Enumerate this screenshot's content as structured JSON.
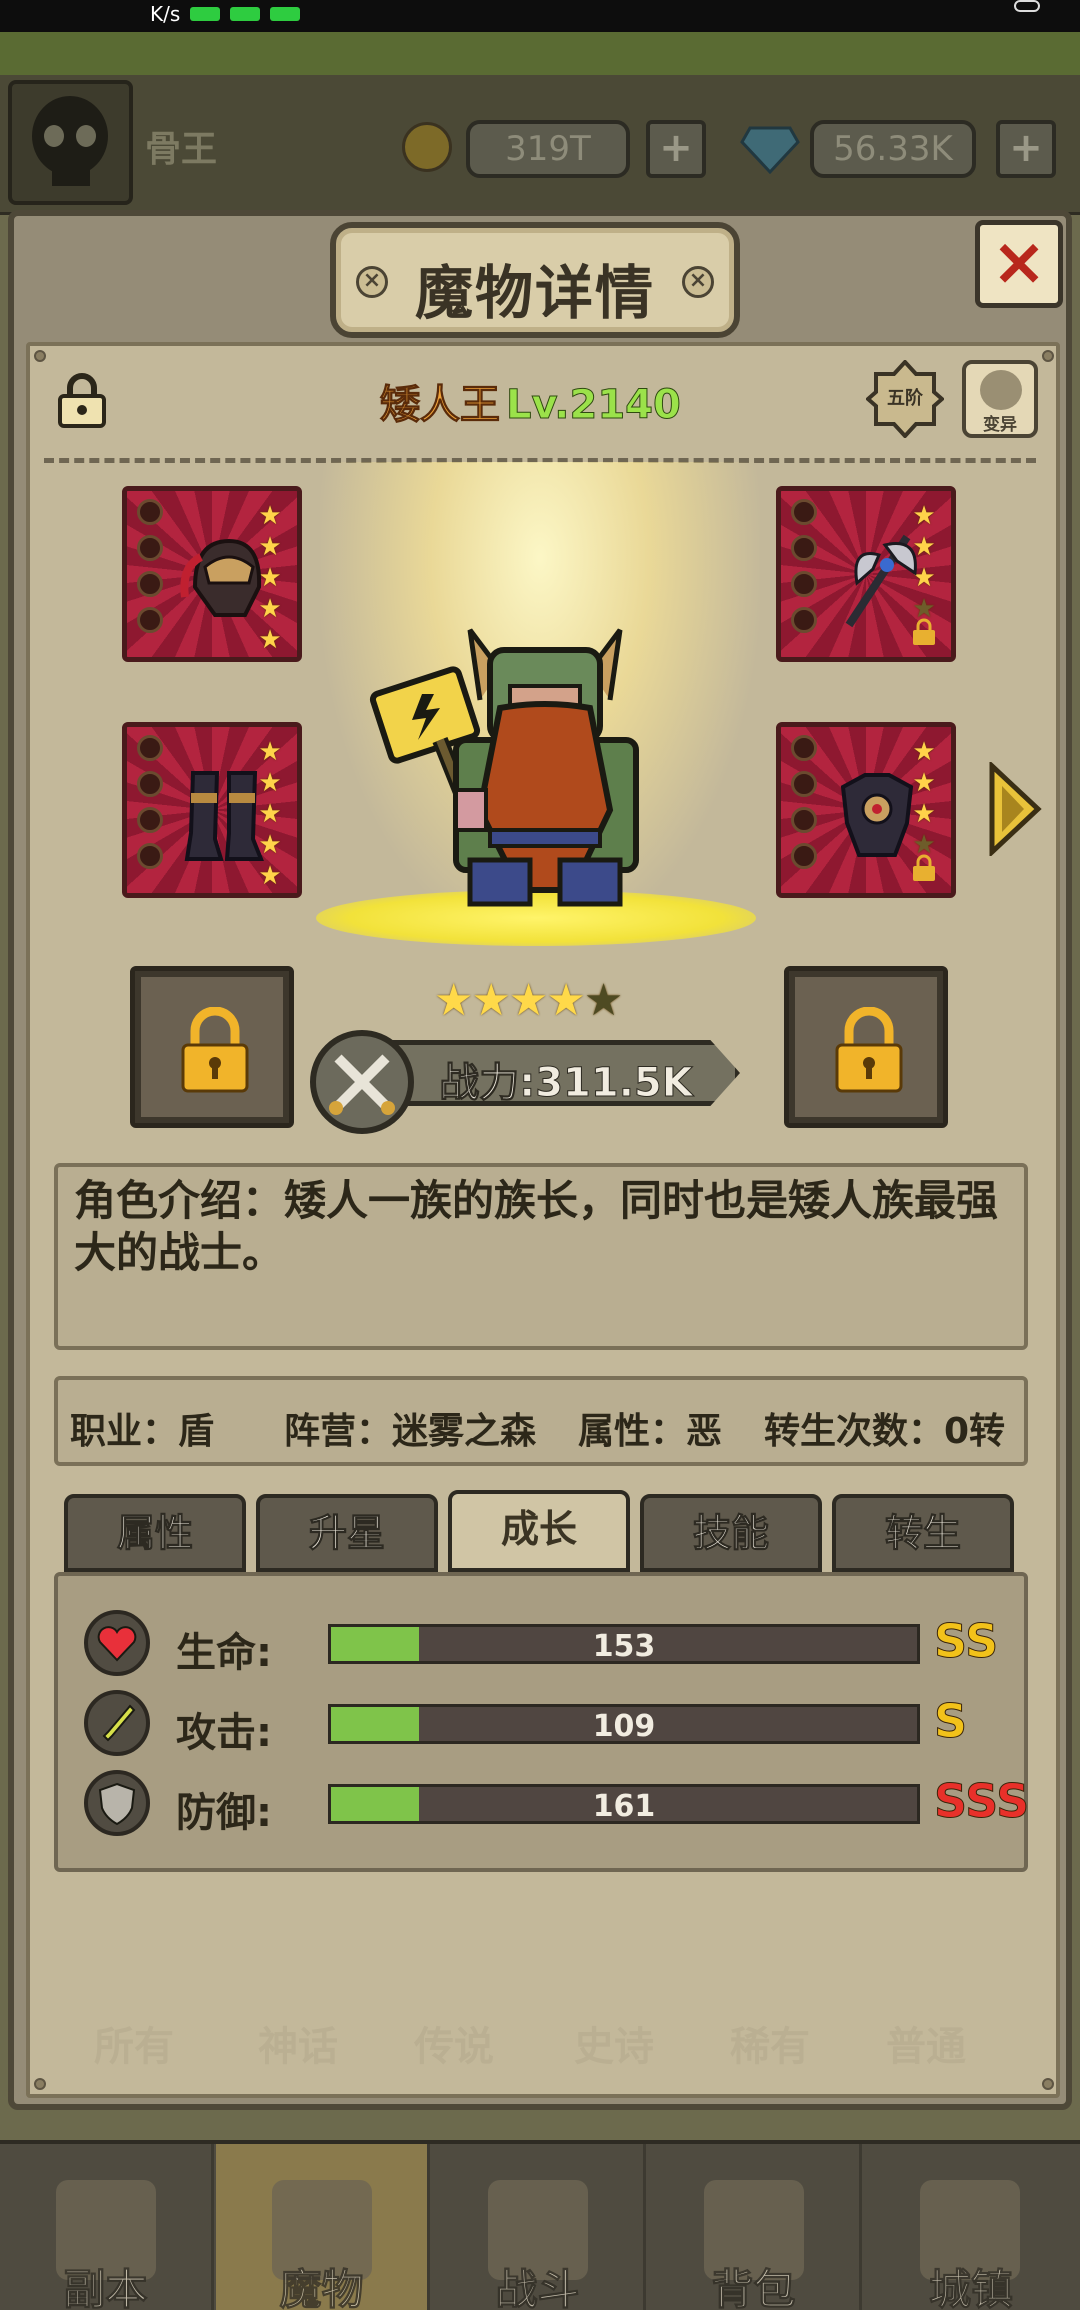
{
  "background": {
    "player_name": "骨王",
    "gold": "319T",
    "gems": "56.33K"
  },
  "popup": {
    "title": "魔物详情",
    "close": "×"
  },
  "monster": {
    "name": "矮人王",
    "level": "Lv.2140",
    "rank": "五阶",
    "mutate_label": "变异",
    "stars_filled": 4,
    "stars_total": 5,
    "power": "战力:311.5K",
    "description": "角色介绍：矮人一族的族长，同时也是矮人族最强大的战士。",
    "info": {
      "class": "职业：盾",
      "faction": "阵营：迷雾之森",
      "attribute": "属性：恶",
      "rebirth": "转生次数：0转"
    }
  },
  "equipment": [
    {
      "name": "helmet",
      "stars": 5,
      "locked": false
    },
    {
      "name": "axe",
      "stars": 3,
      "locked": true
    },
    {
      "name": "boots",
      "stars": 5,
      "locked": false
    },
    {
      "name": "armor",
      "stars": 3,
      "locked": true
    }
  ],
  "tabs": [
    "属性",
    "升星",
    "成长",
    "技能",
    "转生"
  ],
  "active_tab": 2,
  "stats": [
    {
      "label": "生命:",
      "value": "153",
      "fill": 0.15,
      "grade": "SS",
      "grade_color": "#f2c21a"
    },
    {
      "label": "攻击:",
      "value": "109",
      "fill": 0.15,
      "grade": "S",
      "grade_color": "#f2c21a"
    },
    {
      "label": "防御:",
      "value": "161",
      "fill": 0.15,
      "grade": "SSS",
      "grade_color": "#e8302a"
    }
  ],
  "filters": [
    "所有",
    "神话",
    "传说",
    "史诗",
    "稀有",
    "普通"
  ],
  "bottom_nav": [
    "副本",
    "魔物",
    "战斗",
    "背包",
    "城镇"
  ],
  "active_nav": 1
}
